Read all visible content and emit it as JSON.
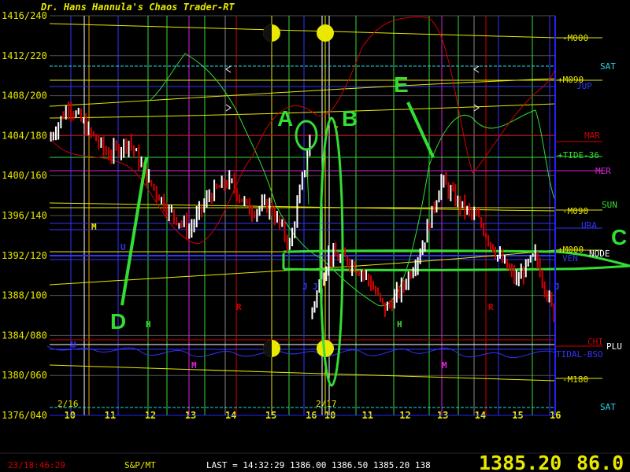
{
  "window": {
    "title": "Dr. Hans Hannula's Chaos Trader-RT"
  },
  "status_bar": {
    "clock": "23/18:46:29",
    "symbol": "S&P/MT",
    "last": "LAST = 14:32:29 1386.00 1386.50 1385.20 138",
    "big_price": "1385.20",
    "big_change": "86.0"
  },
  "colors": {
    "background": "#000000",
    "text": "#e8e800",
    "up_bar": "#ffffff",
    "down_bar": "#d00000",
    "annotation": "#33dd33",
    "border": "#2222ff"
  },
  "chart_data": {
    "type": "line",
    "title": "Dr. Hans Hannula's Chaos Trader-RT",
    "y_tick_labels": [
      "1416/240",
      "1412/220",
      "1408/200",
      "1404/180",
      "1400/160",
      "1396/140",
      "1392/120",
      "1388/100",
      "1384/080",
      "1380/060",
      "1376/040"
    ],
    "y_values": [
      1416,
      1412,
      1408,
      1404,
      1400,
      1396,
      1392,
      1388,
      1384,
      1380,
      1376
    ],
    "ylim": [
      1376,
      1416
    ],
    "x_tick_labels": [
      "10",
      "11",
      "12",
      "13",
      "14",
      "15",
      "16",
      "10",
      "11",
      "12",
      "13",
      "14",
      "15",
      "16"
    ],
    "date_labels": [
      "2/16",
      "2/17"
    ],
    "grid": true,
    "price_series_hourly_close": [
      {
        "t": "2/16 09:30",
        "close": 1403.5
      },
      {
        "t": "2/16 10:00",
        "close": 1407.0
      },
      {
        "t": "2/16 10:30",
        "close": 1404.5
      },
      {
        "t": "2/16 11:00",
        "close": 1402.0
      },
      {
        "t": "2/16 11:30",
        "close": 1403.5
      },
      {
        "t": "2/16 12:00",
        "close": 1399.5
      },
      {
        "t": "2/16 12:30",
        "close": 1396.5
      },
      {
        "t": "2/16 13:00",
        "close": 1394.5
      },
      {
        "t": "2/16 13:30",
        "close": 1398.0
      },
      {
        "t": "2/16 14:00",
        "close": 1399.5
      },
      {
        "t": "2/16 14:30",
        "close": 1396.5
      },
      {
        "t": "2/16 15:00",
        "close": 1397.0
      },
      {
        "t": "2/16 15:30",
        "close": 1393.0
      },
      {
        "t": "2/16 16:00",
        "close": 1403.5
      },
      {
        "t": "2/17 09:30",
        "close": 1386.0
      },
      {
        "t": "2/17 10:00",
        "close": 1392.0
      },
      {
        "t": "2/17 10:30",
        "close": 1391.5
      },
      {
        "t": "2/17 11:00",
        "close": 1390.0
      },
      {
        "t": "2/17 11:30",
        "close": 1386.5
      },
      {
        "t": "2/17 12:00",
        "close": 1389.0
      },
      {
        "t": "2/17 12:30",
        "close": 1393.0
      },
      {
        "t": "2/17 13:00",
        "close": 1399.5
      },
      {
        "t": "2/17 13:30",
        "close": 1397.0
      },
      {
        "t": "2/17 14:00",
        "close": 1395.5
      },
      {
        "t": "2/17 14:30",
        "close": 1392.0
      },
      {
        "t": "2/17 15:00",
        "close": 1389.5
      },
      {
        "t": "2/17 15:30",
        "close": 1392.0
      },
      {
        "t": "2/17 16:00",
        "close": 1386.0
      }
    ],
    "right_labels": [
      {
        "text": "-M000",
        "color": "#e8e800"
      },
      {
        "text": "SAT",
        "color": "#22d8e8"
      },
      {
        "text": "+M090",
        "color": "#e8e800"
      },
      {
        "text": "JUP",
        "color": "#3333ff"
      },
      {
        "text": "MAR",
        "color": "#d00000"
      },
      {
        "text": "+TIDE-36",
        "color": "#33dd33"
      },
      {
        "text": "MER",
        "color": "#dd22dd"
      },
      {
        "text": "-M090",
        "color": "#e8e800"
      },
      {
        "text": "SUN",
        "color": "#33dd33"
      },
      {
        "text": "URA",
        "color": "#3333ff"
      },
      {
        "text": "+M000",
        "color": "#e8e800"
      },
      {
        "text": "NODE",
        "color": "#ffffff"
      },
      {
        "text": "VEN",
        "color": "#3333ff"
      },
      {
        "text": "CHI",
        "color": "#d00000"
      },
      {
        "text": "PLU",
        "color": "#ffffff"
      },
      {
        "text": "TIDAL-BSO",
        "color": "#3333ff"
      },
      {
        "text": "-M180",
        "color": "#e8e800"
      },
      {
        "text": "SAT",
        "color": "#22d8e8"
      }
    ],
    "chart_letters": [
      {
        "text": "U",
        "color": "#3333ff"
      },
      {
        "text": "U",
        "color": "#3333ff"
      },
      {
        "text": "U",
        "color": "#3333ff"
      },
      {
        "text": "J",
        "color": "#3333ff"
      },
      {
        "text": "J",
        "color": "#3333ff"
      },
      {
        "text": "J",
        "color": "#3333ff"
      },
      {
        "text": "H",
        "color": "#33dd33"
      },
      {
        "text": "H",
        "color": "#33dd33"
      },
      {
        "text": "R",
        "color": "#d00000"
      },
      {
        "text": "R",
        "color": "#d00000"
      },
      {
        "text": "M",
        "color": "#dd22dd"
      },
      {
        "text": "M",
        "color": "#dd22dd"
      },
      {
        "text": "L",
        "color": "#e8e800"
      },
      {
        "text": "M",
        "color": "#e8e800"
      }
    ],
    "annotations": [
      "A",
      "B",
      "C",
      "D",
      "E"
    ],
    "moon_phases": [
      "first-quarter",
      "full",
      "first-quarter",
      "full"
    ]
  }
}
